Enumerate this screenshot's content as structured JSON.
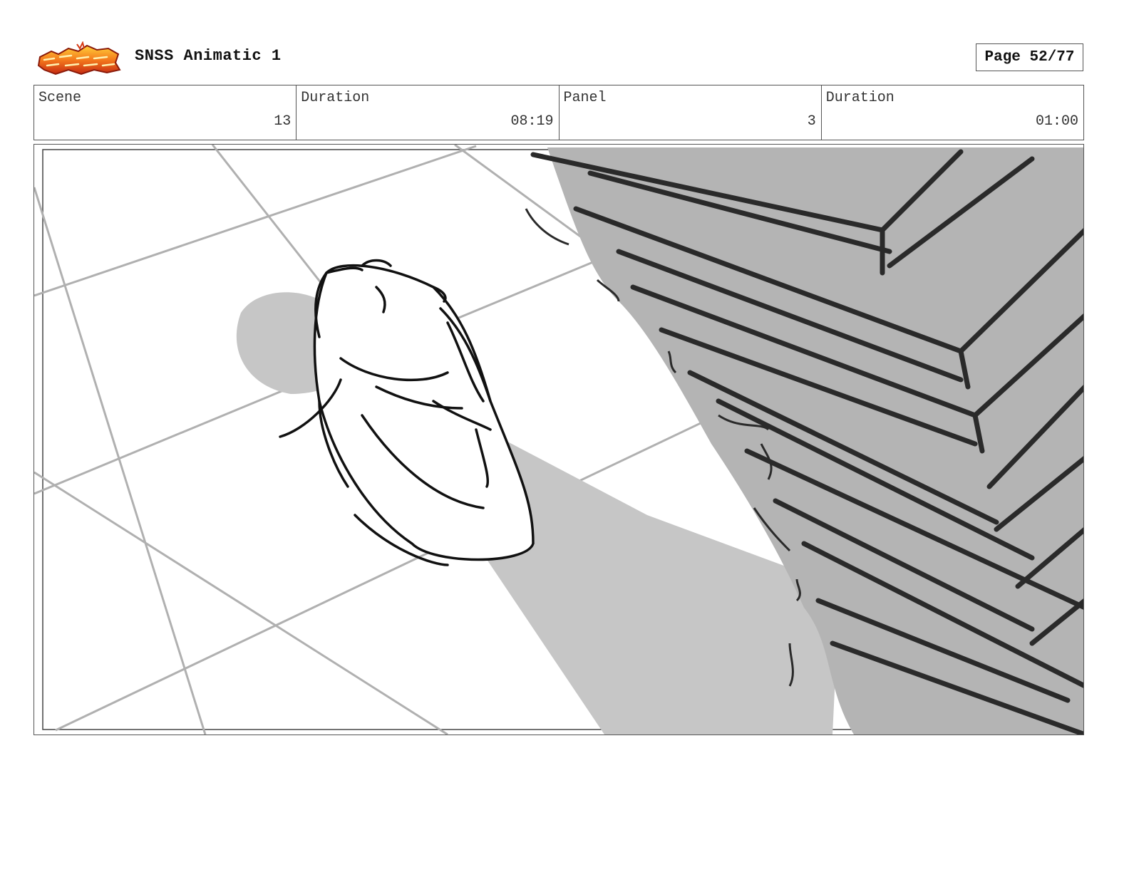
{
  "header": {
    "logo_icon": "snss-logo-icon",
    "title": "SNSS Animatic 1",
    "page_label": "Page 52/77"
  },
  "info": [
    {
      "label": "Scene",
      "value": "13"
    },
    {
      "label": "Duration",
      "value": "08:19"
    },
    {
      "label": "Panel",
      "value": "3"
    },
    {
      "label": "Duration",
      "value": "01:00"
    }
  ],
  "panel": {
    "image_icon": "storyboard-sketch-image"
  }
}
